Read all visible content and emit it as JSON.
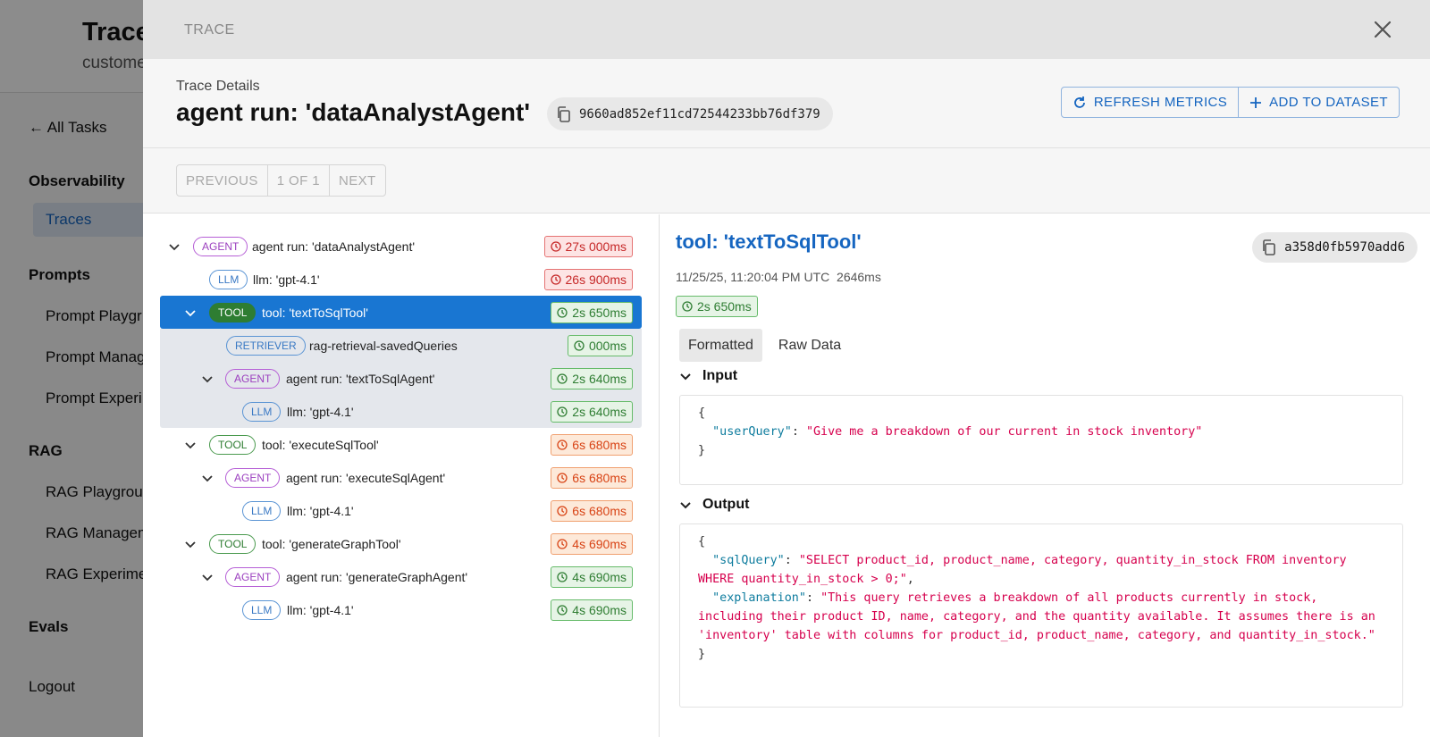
{
  "background": {
    "title": "Trace",
    "subtitle": "custome",
    "back_link": "← All Tasks",
    "sections": [
      {
        "heading": "Observability",
        "items": [
          "Traces"
        ]
      },
      {
        "heading": "Prompts",
        "items": [
          "Prompt Playgr",
          "Prompt Manag",
          "Prompt Experi"
        ]
      },
      {
        "heading": "RAG",
        "items": [
          "RAG Playgroun",
          "RAG Managem",
          "RAG Experime"
        ]
      },
      {
        "heading": "Evals",
        "items": []
      }
    ],
    "logout": "Logout"
  },
  "drawer": {
    "label": "TRACE",
    "header": {
      "small_title": "Trace Details",
      "title": "agent run: 'dataAnalystAgent'",
      "trace_id": "9660ad852ef11cd72544233bb76df379",
      "refresh_label": "REFRESH METRICS",
      "add_label": "ADD TO DATASET"
    },
    "pager": {
      "previous": "PREVIOUS",
      "position": "1 OF 1",
      "next": "NEXT"
    },
    "tree": [
      {
        "tag": "AGENT",
        "kind": "agent",
        "name": "agent run: 'dataAnalystAgent'",
        "duration": "27s 000ms",
        "status": "red"
      },
      {
        "tag": "LLM",
        "kind": "llm",
        "name": "llm: 'gpt-4.1'",
        "duration": "26s 900ms",
        "status": "red"
      },
      {
        "tag": "TOOL",
        "kind": "tool",
        "name": "tool: 'textToSqlTool'",
        "duration": "2s 650ms",
        "status": "green"
      },
      {
        "tag": "RETRIEVER",
        "kind": "retr",
        "name": "rag-retrieval-savedQueries",
        "duration": "000ms",
        "status": "green"
      },
      {
        "tag": "AGENT",
        "kind": "agent",
        "name": "agent run: 'textToSqlAgent'",
        "duration": "2s 640ms",
        "status": "green"
      },
      {
        "tag": "LLM",
        "kind": "llm",
        "name": "llm: 'gpt-4.1'",
        "duration": "2s 640ms",
        "status": "green"
      },
      {
        "tag": "TOOL",
        "kind": "tool",
        "name": "tool: 'executeSqlTool'",
        "duration": "6s 680ms",
        "status": "orange"
      },
      {
        "tag": "AGENT",
        "kind": "agent",
        "name": "agent run: 'executeSqlAgent'",
        "duration": "6s 680ms",
        "status": "orange"
      },
      {
        "tag": "LLM",
        "kind": "llm",
        "name": "llm: 'gpt-4.1'",
        "duration": "6s 680ms",
        "status": "orange"
      },
      {
        "tag": "TOOL",
        "kind": "tool",
        "name": "tool: 'generateGraphTool'",
        "duration": "4s 690ms",
        "status": "orange"
      },
      {
        "tag": "AGENT",
        "kind": "agent",
        "name": "agent run: 'generateGraphAgent'",
        "duration": "4s 690ms",
        "status": "green"
      },
      {
        "tag": "LLM",
        "kind": "llm",
        "name": "llm: 'gpt-4.1'",
        "duration": "4s 690ms",
        "status": "green"
      }
    ],
    "detail": {
      "title": "tool: 'textToSqlTool'",
      "span_id": "a358d0fb5970add6",
      "timestamp": "11/25/25, 11:20:04 PM UTC",
      "latency": "2646ms",
      "duration": "2s 650ms",
      "tabs": [
        "Formatted",
        "Raw Data"
      ],
      "input_label": "Input",
      "output_label": "Output",
      "input": {
        "open": "{",
        "key": "\"userQuery\"",
        "value": "\"Give me a breakdown of our current in stock inventory\"",
        "close": "}"
      },
      "output": {
        "open": "{",
        "key1": "\"sqlQuery\"",
        "value1": "\"SELECT product_id, product_name, category, quantity_in_stock FROM inventory WHERE quantity_in_stock > 0;\"",
        "key2": "\"explanation\"",
        "value2": "\"This query retrieves a breakdown of all products currently in stock, including their product ID, name, category, and the quantity available. It assumes there is an 'inventory' table with columns for product_id, product_name, category, and quantity_in_stock.\"",
        "close": "}"
      }
    }
  }
}
